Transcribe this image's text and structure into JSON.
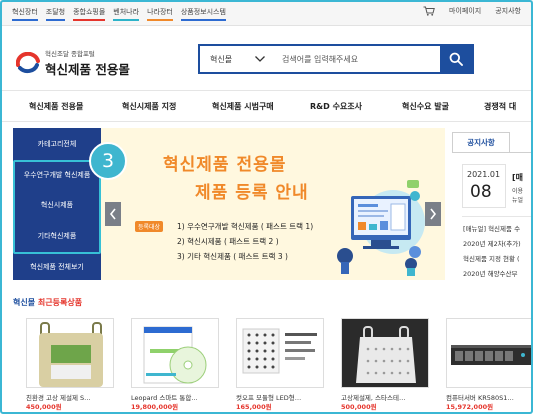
{
  "top_sites": [
    {
      "label": "혁신장터",
      "color": "#2d6bd1"
    },
    {
      "label": "조달청",
      "color": "#2d6bd1"
    },
    {
      "label": "종합쇼핑몰",
      "color": "#e5352c"
    },
    {
      "label": "벤처나라",
      "color": "#2db3c9"
    },
    {
      "label": "나라장터",
      "color": "#f0892a"
    },
    {
      "label": "상품정보시스템",
      "color": "#2d6bd1"
    }
  ],
  "utility": {
    "cart_icon": "shopping-cart-icon",
    "mypage": "마이페이지",
    "notice": "공지사항"
  },
  "logo": {
    "sub": "혁신조달 종합포털",
    "main": "혁신제품 전용몰"
  },
  "search": {
    "category": "혁신몰",
    "placeholder": "검색어를 입력해주세요",
    "button_icon": "search-icon",
    "accent": "#1d4e9e"
  },
  "nav": [
    "혁신제품 전용몰",
    "혁신시제품 지정",
    "혁신제품 시범구매",
    "R&D 수요조사",
    "혁신수요 발굴",
    "경쟁적 대"
  ],
  "categories": [
    "카테고리전체",
    "우수연구개발 혁신제품",
    "혁신시제품",
    "기타혁신제품",
    "혁신제품 전체보기"
  ],
  "step_badge": "3",
  "banner": {
    "title1": "혁신제품 전용몰",
    "title2": "제품 등록 안내",
    "tag": "등록대상",
    "lines": [
      "1) 우수연구개발 혁신제품 ( 패스트 트랙 1)",
      "2) 혁신시제품 ( 패스트 트랙 2 )",
      "3) 기타 혁신제품 ( 패스트 트랙 3 )"
    ]
  },
  "notice": {
    "tab": "공지사항",
    "month": "2021.01",
    "day": "08",
    "bracket": "[매",
    "side_lines": [
      "이용",
      "뉴얼"
    ],
    "items": [
      "[매뉴얼] 혁신제품 수",
      "2020년 제2차(추가)",
      "혁신제품 지정 현황 (",
      "2020년 해양수산부"
    ]
  },
  "recent": {
    "title_prefix": "혁신몰",
    "title_suffix": "최근등록상품",
    "products": [
      {
        "name": "친환경 고상 제설제 S…",
        "price": "450,000원"
      },
      {
        "name": "Leopard 스마트 통합…",
        "price": "19,800,000원"
      },
      {
        "name": "컷오프 모듈형 LED형…",
        "price": "165,000원"
      },
      {
        "name": "고상제설제, 스타스테…",
        "price": "500,000원"
      },
      {
        "name": "컴퓨터서버 KR580S1…",
        "price": "15,972,000원"
      }
    ]
  }
}
